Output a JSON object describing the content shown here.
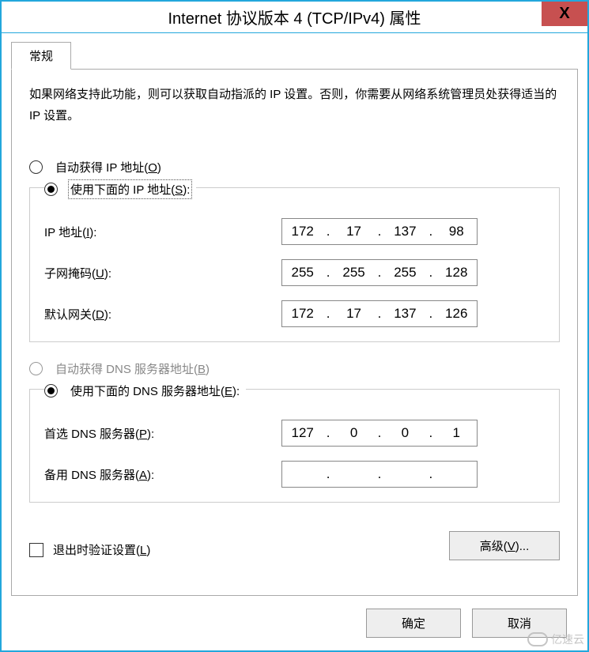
{
  "window": {
    "title": "Internet 协议版本 4 (TCP/IPv4) 属性",
    "close": "X"
  },
  "tab": {
    "label": "常规"
  },
  "description": "如果网络支持此功能，则可以获取自动指派的 IP 设置。否则，你需要从网络系统管理员处获得适当的 IP 设置。",
  "ip_section": {
    "auto": "自动获得 IP 地址(",
    "auto_key": "O",
    "auto_suffix": ")",
    "manual": "使用下面的 IP 地址(",
    "manual_key": "S",
    "manual_suffix": "):",
    "ip_label": "IP 地址(",
    "ip_key": "I",
    "ip_suffix": "):",
    "ip_value": {
      "a": "172",
      "b": "17",
      "c": "137",
      "d": "98"
    },
    "mask_label": "子网掩码(",
    "mask_key": "U",
    "mask_suffix": "):",
    "mask_value": {
      "a": "255",
      "b": "255",
      "c": "255",
      "d": "128"
    },
    "gw_label": "默认网关(",
    "gw_key": "D",
    "gw_suffix": "):",
    "gw_value": {
      "a": "172",
      "b": "17",
      "c": "137",
      "d": "126"
    }
  },
  "dns_section": {
    "auto": "自动获得 DNS 服务器地址(",
    "auto_key": "B",
    "auto_suffix": ")",
    "manual": "使用下面的 DNS 服务器地址(",
    "manual_key": "E",
    "manual_suffix": "):",
    "pref_label": "首选 DNS 服务器(",
    "pref_key": "P",
    "pref_suffix": "):",
    "pref_value": {
      "a": "127",
      "b": "0",
      "c": "0",
      "d": "1"
    },
    "alt_label": "备用 DNS 服务器(",
    "alt_key": "A",
    "alt_suffix": "):",
    "alt_value": {
      "a": "",
      "b": "",
      "c": "",
      "d": ""
    }
  },
  "validate": {
    "label": "退出时验证设置(",
    "key": "L",
    "suffix": ")"
  },
  "advanced": {
    "label": "高级(",
    "key": "V",
    "suffix": ")..."
  },
  "footer": {
    "ok": "确定",
    "cancel": "取消"
  },
  "watermark": "亿速云",
  "dot": "."
}
